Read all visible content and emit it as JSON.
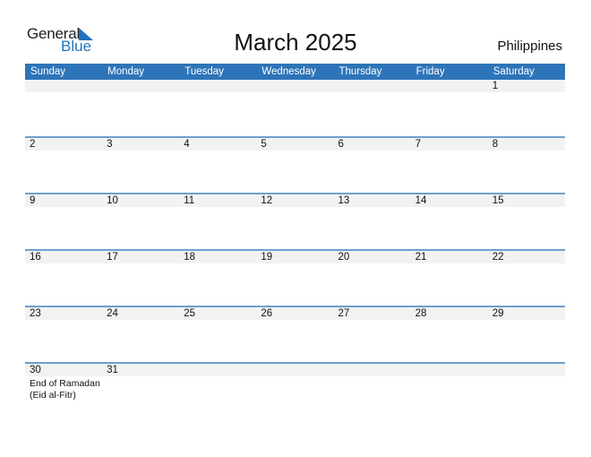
{
  "logo": {
    "word1": "General",
    "word2": "Blue"
  },
  "title": "March 2025",
  "country": "Philippines",
  "colors": {
    "header": "#2e74b8",
    "accent": "#1f73c1",
    "divider": "#6f9fd0",
    "strip": "#f2f2f2"
  },
  "weekdays": [
    "Sunday",
    "Monday",
    "Tuesday",
    "Wednesday",
    "Thursday",
    "Friday",
    "Saturday"
  ],
  "weeks": [
    {
      "days": [
        "",
        "",
        "",
        "",
        "",
        "",
        "1"
      ],
      "notes": [
        "",
        "",
        "",
        "",
        "",
        "",
        ""
      ]
    },
    {
      "days": [
        "2",
        "3",
        "4",
        "5",
        "6",
        "7",
        "8"
      ],
      "notes": [
        "",
        "",
        "",
        "",
        "",
        "",
        ""
      ]
    },
    {
      "days": [
        "9",
        "10",
        "11",
        "12",
        "13",
        "14",
        "15"
      ],
      "notes": [
        "",
        "",
        "",
        "",
        "",
        "",
        ""
      ]
    },
    {
      "days": [
        "16",
        "17",
        "18",
        "19",
        "20",
        "21",
        "22"
      ],
      "notes": [
        "",
        "",
        "",
        "",
        "",
        "",
        ""
      ]
    },
    {
      "days": [
        "23",
        "24",
        "25",
        "26",
        "27",
        "28",
        "29"
      ],
      "notes": [
        "",
        "",
        "",
        "",
        "",
        "",
        ""
      ]
    },
    {
      "days": [
        "30",
        "31",
        "",
        "",
        "",
        "",
        ""
      ],
      "notes": [
        "End of Ramadan (Eid al-Fitr)",
        "",
        "",
        "",
        "",
        "",
        ""
      ]
    }
  ]
}
